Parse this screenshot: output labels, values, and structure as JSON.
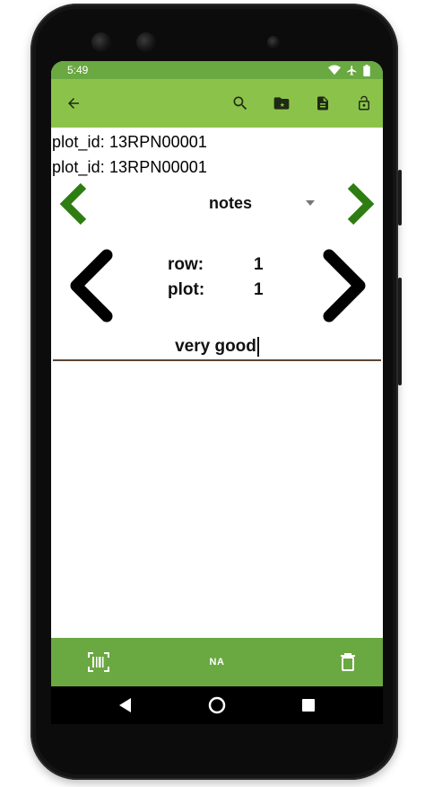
{
  "status_bar": {
    "time": "5:49",
    "icons": [
      "wifi-icon",
      "airplane-icon",
      "battery-icon"
    ]
  },
  "toolbar": {
    "back_icon": "back-arrow-icon",
    "actions": [
      "search-icon",
      "folder-star-icon",
      "document-icon",
      "lock-icon"
    ]
  },
  "info": {
    "line1": "plot_id: 13RPN00001",
    "line2": "plot_id: 13RPN00001"
  },
  "trait": {
    "selected": "notes",
    "prev_icon": "chevron-left-icon",
    "next_icon": "chevron-right-icon"
  },
  "range": {
    "row_label": "row:",
    "row_value": "1",
    "plot_label": "plot:",
    "plot_value": "1"
  },
  "input": {
    "value": "very good"
  },
  "bottom_bar": {
    "na_label": "NA",
    "icons": [
      "barcode-scan-icon",
      "delete-icon"
    ]
  },
  "colors": {
    "status_bar": "#6aa841",
    "app_bar": "#8bc34a",
    "bottom_bar": "#6aa841",
    "trait_arrow": "#2e7d12"
  }
}
